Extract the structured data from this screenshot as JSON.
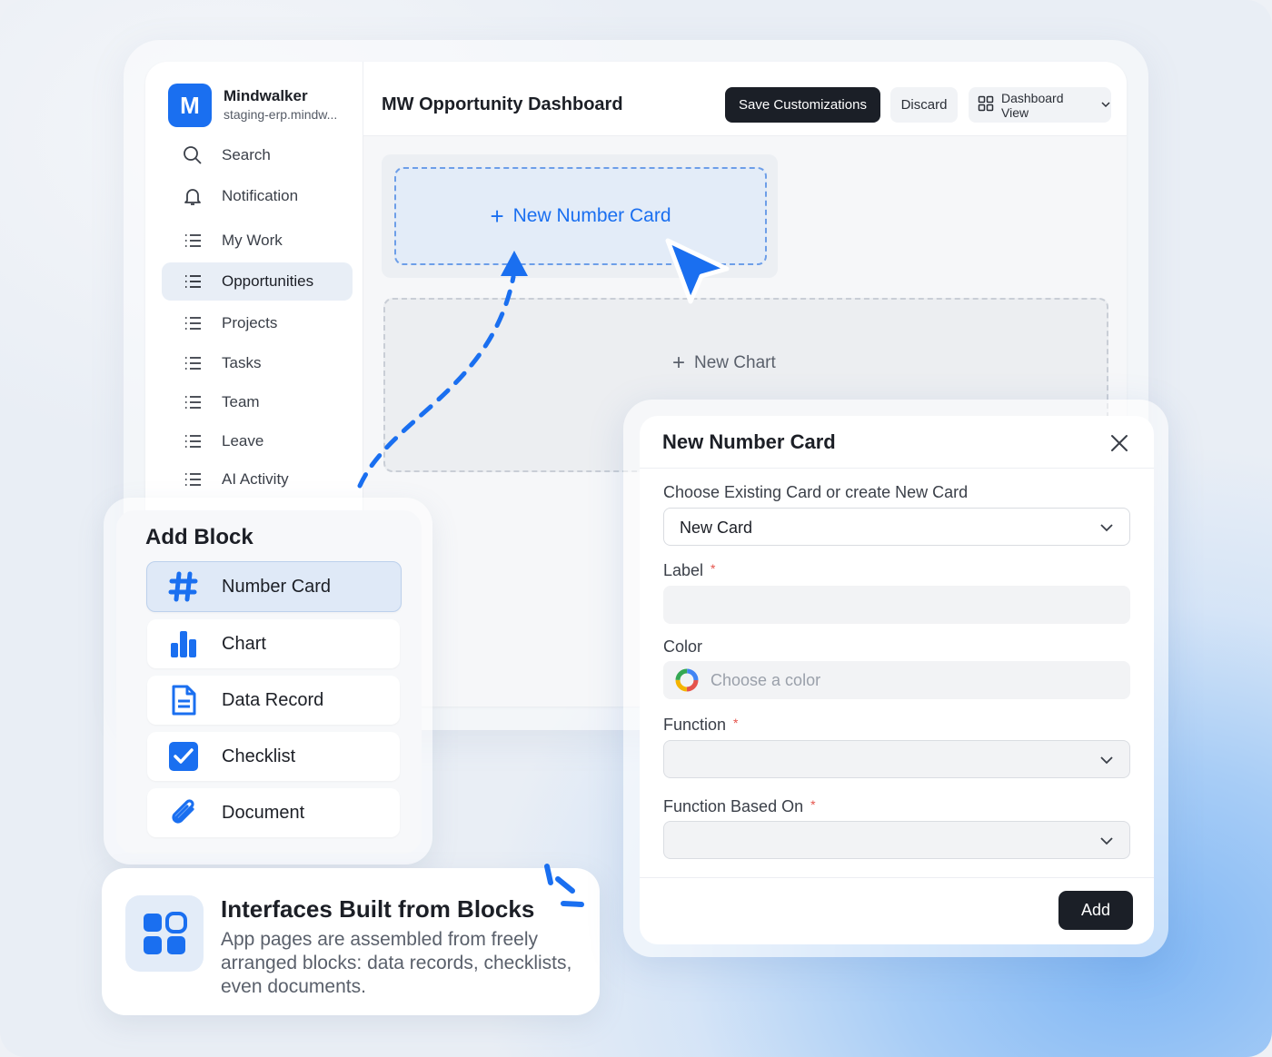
{
  "app": {
    "brand_letter": "M",
    "brand_name": "Mindwalker",
    "brand_subtitle": "staging-erp.mindw...",
    "accent_color": "#1a6ff0"
  },
  "sidebar": {
    "items": [
      {
        "label": "Search",
        "icon": "search-icon"
      },
      {
        "label": "Notification",
        "icon": "bell-icon"
      },
      {
        "label": "My Work",
        "icon": "list-icon"
      },
      {
        "label": "Opportunities",
        "icon": "list-icon",
        "active": true
      },
      {
        "label": "Projects",
        "icon": "list-icon"
      },
      {
        "label": "Tasks",
        "icon": "list-icon"
      },
      {
        "label": "Team",
        "icon": "list-icon"
      },
      {
        "label": "Leave",
        "icon": "list-icon"
      },
      {
        "label": "AI Activity",
        "icon": "list-icon"
      }
    ]
  },
  "header": {
    "title": "MW Opportunity Dashboard",
    "save_label": "Save Customizations",
    "discard_label": "Discard",
    "view_label": "Dashboard View"
  },
  "canvas": {
    "new_number_card_label": "New Number Card",
    "new_chart_label": "New Chart"
  },
  "add_block": {
    "title": "Add Block",
    "items": [
      {
        "label": "Number Card",
        "icon": "hash-icon",
        "active": true
      },
      {
        "label": "Chart",
        "icon": "bar-chart-icon"
      },
      {
        "label": "Data Record",
        "icon": "document-icon"
      },
      {
        "label": "Checklist",
        "icon": "checkbox-icon"
      },
      {
        "label": "Document",
        "icon": "paperclip-icon"
      }
    ]
  },
  "info_card": {
    "title": "Interfaces Built from Blocks",
    "description": "App pages are assembled from freely arranged blocks: data records, checklists, even documents."
  },
  "modal": {
    "title": "New Number Card",
    "choose_label": "Choose Existing Card or create New Card",
    "choose_value": "New Card",
    "label_label": "Label",
    "label_value": "",
    "color_label": "Color",
    "color_placeholder": "Choose a color",
    "function_label": "Function",
    "function_value": "",
    "function_based_on_label": "Function Based On",
    "function_based_on_value": "",
    "required_mark": "*",
    "add_label": "Add"
  }
}
